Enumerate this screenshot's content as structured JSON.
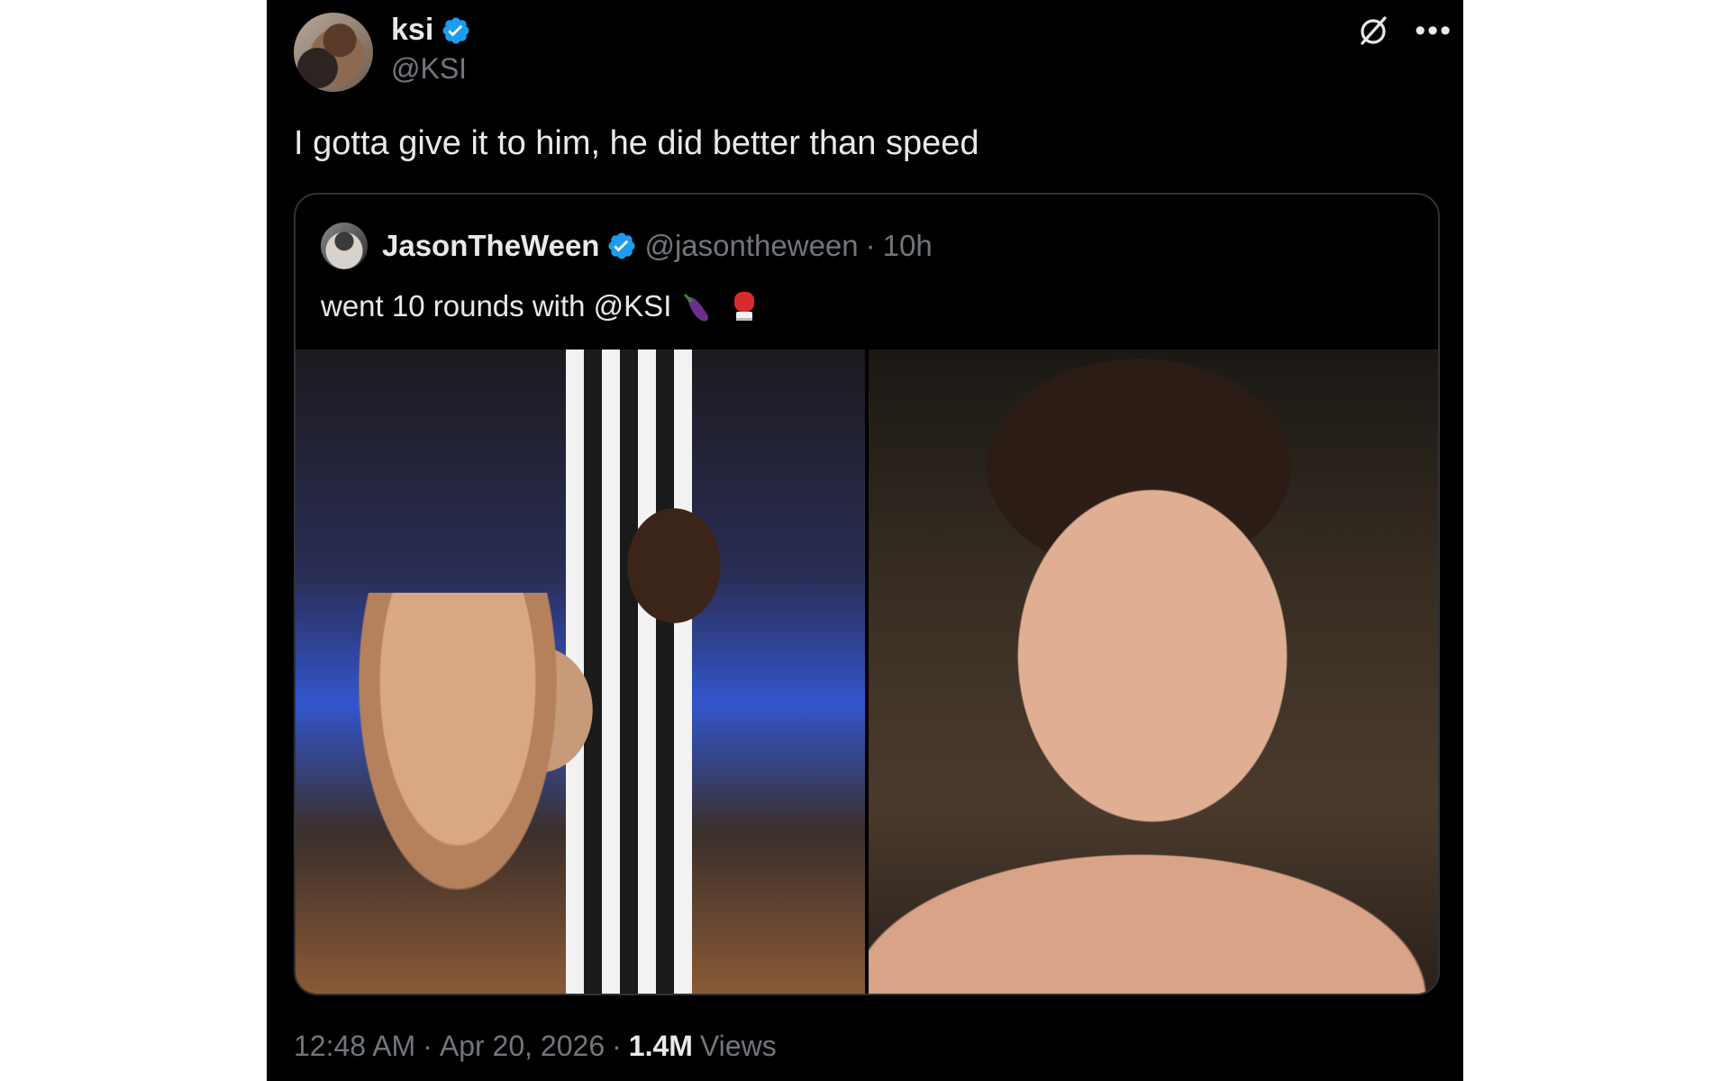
{
  "author": {
    "display_name": "ksi",
    "handle": "@KSI",
    "verified": true
  },
  "tweet": {
    "text": "I gotta give it to him, he did better than speed"
  },
  "quoted_tweet": {
    "display_name": "JasonTheWeen",
    "handle": "@jasontheween",
    "separator": "·",
    "time": "10h",
    "text": "went 10 rounds with @KSI",
    "emojis": [
      "eggplant-emoji",
      "boxing-glove-emoji"
    ],
    "media": [
      "boxing-gym-photo",
      "selfie-photo"
    ]
  },
  "footer": {
    "time": "12:48 AM",
    "sep1": "·",
    "date": "Apr 20, 2026",
    "sep2": "·",
    "views_count": "1.4M",
    "views_label": "Views"
  },
  "colors": {
    "background": "#000000",
    "text": "#e7e9ea",
    "muted": "#71767b",
    "verified": "#1d9bf0",
    "border": "#2f3336"
  },
  "icons": {
    "verified": "verified-badge-icon",
    "grok": "grok-icon",
    "more": "more-icon"
  }
}
